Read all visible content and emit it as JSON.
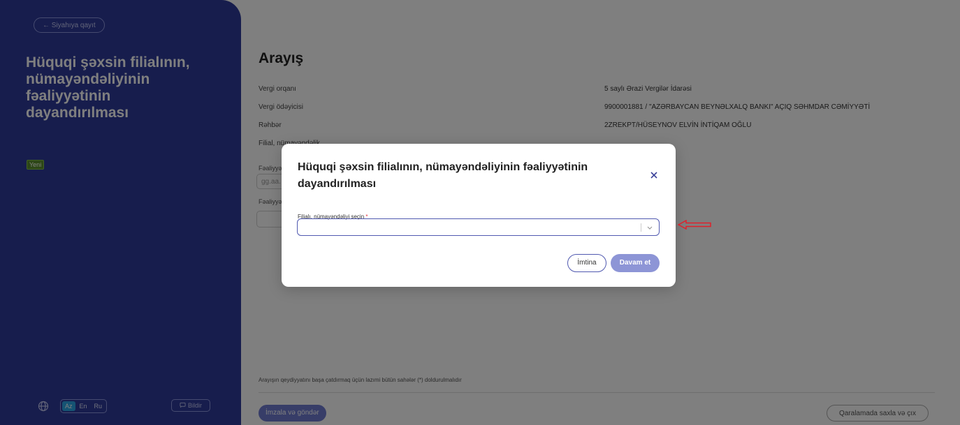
{
  "sidebar": {
    "back_label": "← Siyahıya qayıt",
    "title": "Hüquqi şəxsin filialının, nümayəndəliyinin fəaliyyətinin dayandırılması",
    "status_badge": "Yeni",
    "languages": [
      "Az",
      "En",
      "Ru"
    ],
    "active_language": "Az",
    "flag_label": "Bildir"
  },
  "main": {
    "title": "Arayış",
    "rows": [
      {
        "label": "Vergi orqanı",
        "value": "5 saylı Ərazi Vergilər İdarəsi"
      },
      {
        "label": "Vergi ödəyicisi",
        "value": "9900001881 / \"AZƏRBAYCAN BEYNƏLXALQ BANKI\" AÇIQ SƏHMDAR CƏMİYYƏTİ"
      },
      {
        "label": "Rəhbər",
        "value": "2ZREKPT/HÜSEYNOV ELVİN İNTİQAM OĞLU"
      },
      {
        "label": "Filial, nümayəndəlik",
        "value": ""
      }
    ],
    "field1_label": "Fəaliyyə",
    "field1_placeholder": "gg.aa.",
    "field2_label": "Fəaliyyə",
    "footer_note": "Arayışın qeydiyyatını başa çatdırmaq üçün lazımi bütün sahələr (*) doldurulmalıdır",
    "sign_button": "İmzala və göndər",
    "draft_button": "Qaralamada saxla və çıx"
  },
  "modal": {
    "title": "Hüquqi şəxsin filialının, nümayəndəliyinin fəaliyyətinin dayandırılması",
    "field_label": "Filialı, nümayəndəliyi seçin",
    "required_mark": "*",
    "select_value": "",
    "cancel_button": "İmtina",
    "continue_button": "Davam et"
  },
  "colors": {
    "sidebar_bg": "#2f3b9a",
    "accent": "#5059b0",
    "annotation_arrow": "#e0202a",
    "overlay": "rgba(0,0,0,0.5)"
  }
}
